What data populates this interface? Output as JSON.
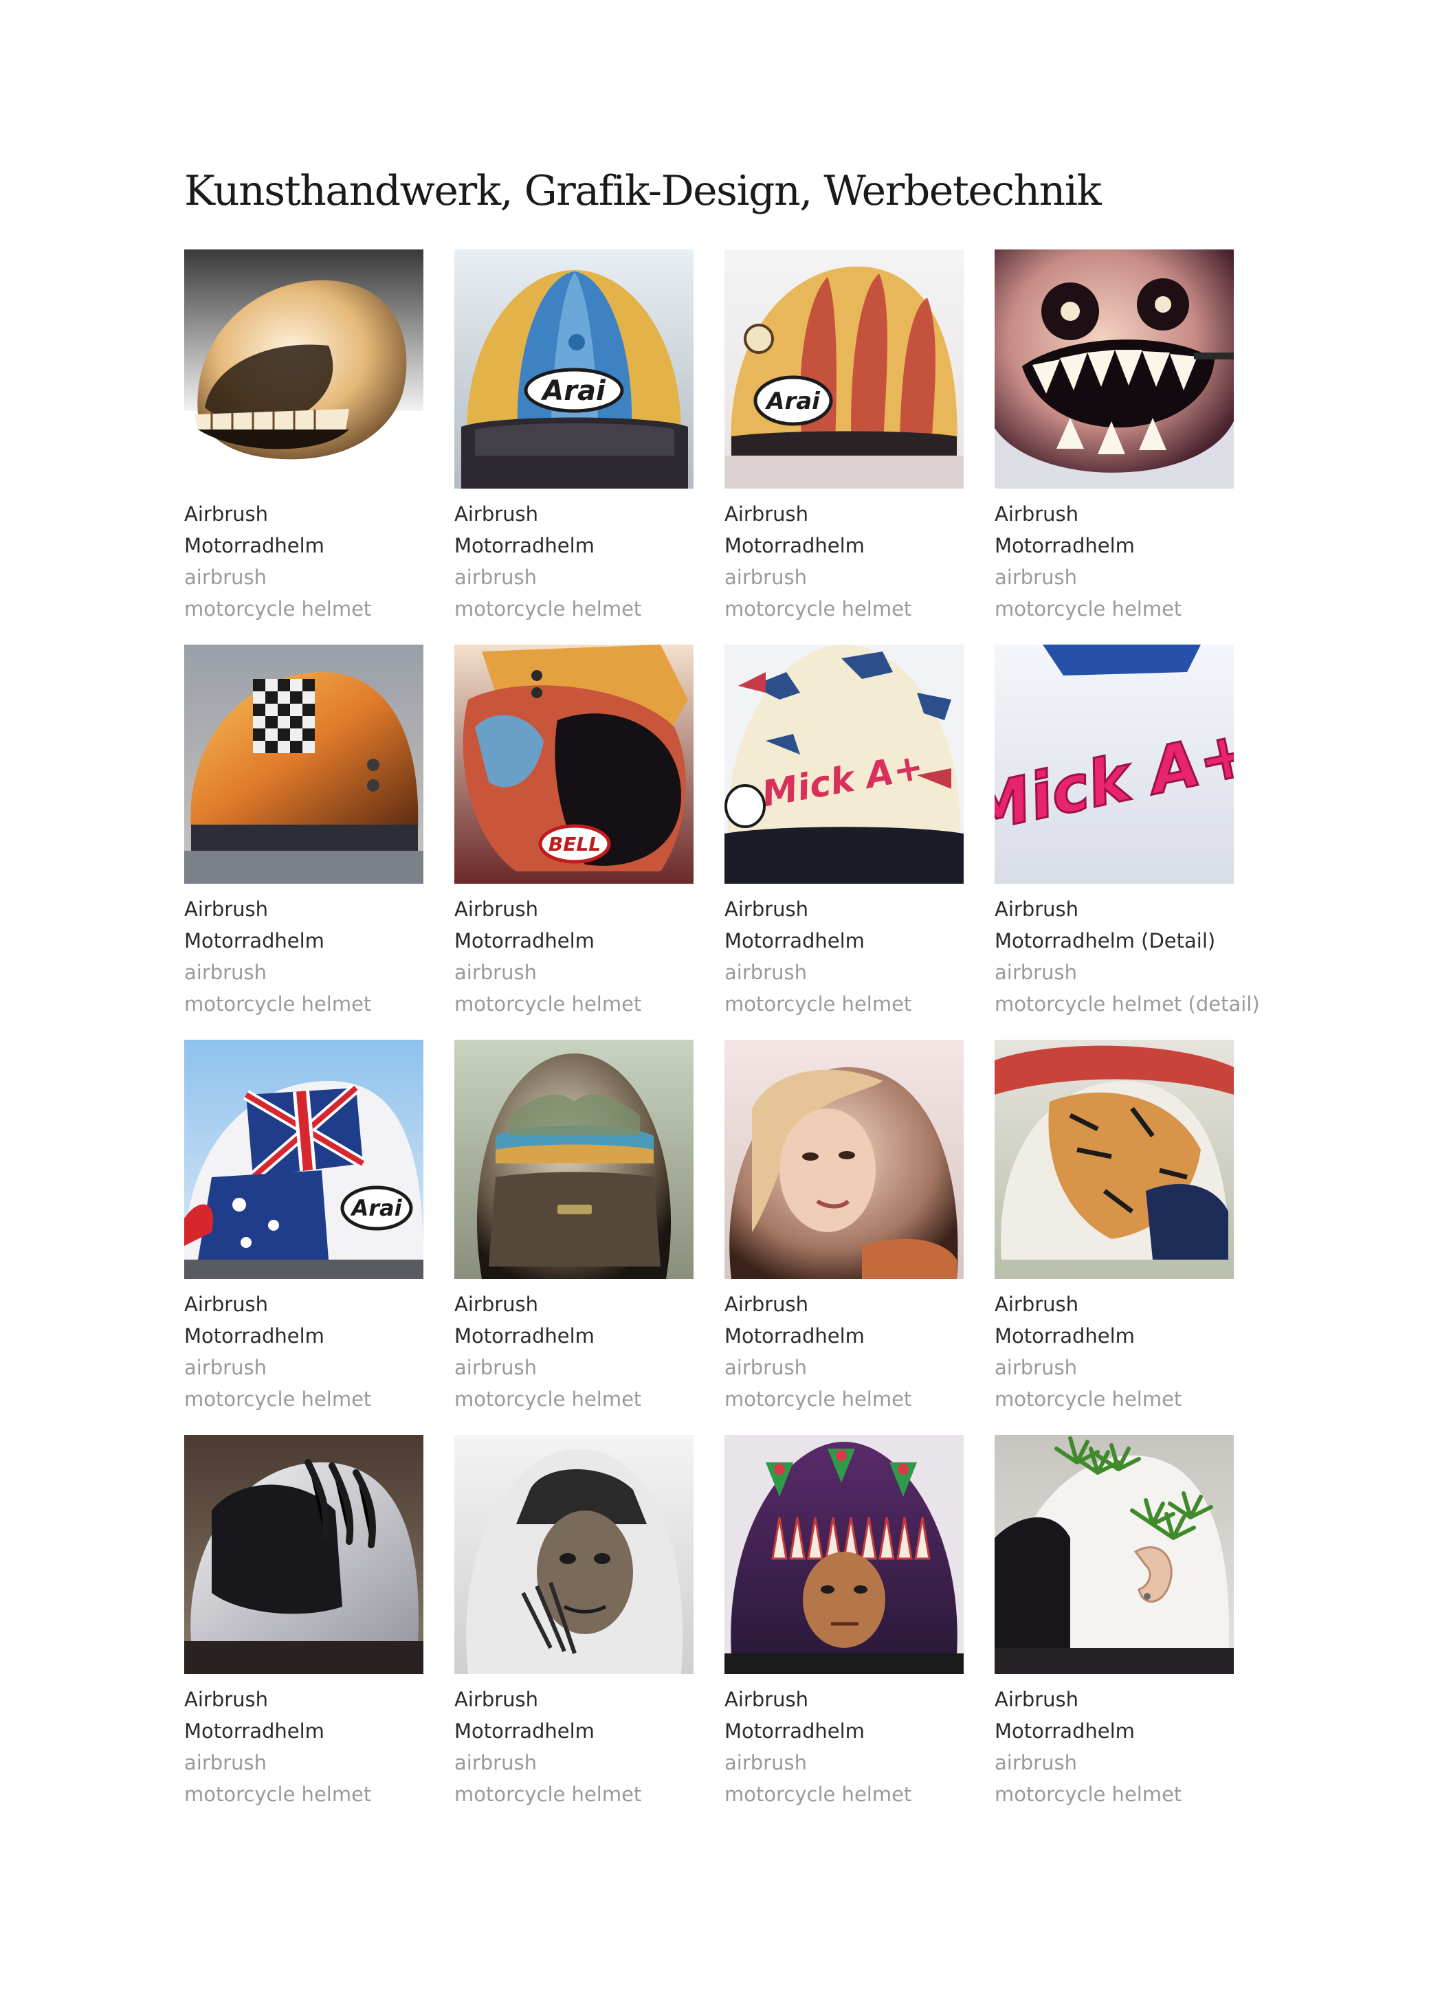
{
  "page": {
    "title": "Kunsthandwerk, Grafik-Design, Werbetechnik"
  },
  "colors": {
    "text_primary": "#2b2b2b",
    "text_secondary": "#9a9a9a",
    "background": "#ffffff"
  },
  "gallery": [
    {
      "line1": "Airbrush",
      "line2": "Motorradhelm",
      "line3": "airbrush",
      "line4": "motorcycle helmet",
      "image": "skull-face-helmet",
      "logo": ""
    },
    {
      "line1": "Airbrush",
      "line2": "Motorradhelm",
      "line3": "airbrush",
      "line4": "motorcycle helmet",
      "image": "blue-striped-arai-helmet",
      "logo": "Arai"
    },
    {
      "line1": "Airbrush",
      "line2": "Motorradhelm",
      "line3": "airbrush",
      "line4": "motorcycle helmet",
      "image": "red-yellow-striped-arai-helmet",
      "logo": "Arai"
    },
    {
      "line1": "Airbrush",
      "line2": "Motorradhelm",
      "line3": "airbrush",
      "line4": "motorcycle helmet",
      "image": "monster-teeth-helmet",
      "logo": ""
    },
    {
      "line1": "Airbrush",
      "line2": "Motorradhelm",
      "line3": "airbrush",
      "line4": "motorcycle helmet",
      "image": "checkered-flame-helmet",
      "logo": ""
    },
    {
      "line1": "Airbrush",
      "line2": "Motorradhelm",
      "line3": "airbrush",
      "line4": "motorcycle helmet",
      "image": "bell-motocross-helmet",
      "logo": "BELL"
    },
    {
      "line1": "Airbrush",
      "line2": "Motorradhelm",
      "line3": "airbrush",
      "line4": "motorcycle helmet",
      "image": "mick-a-plus-helmet",
      "logo": "Mick A+"
    },
    {
      "line1": "Airbrush",
      "line2": "Motorradhelm (Detail)",
      "line3": "airbrush",
      "line4": "motorcycle helmet (detail)",
      "image": "mick-a-plus-detail",
      "logo": "Mick A+"
    },
    {
      "line1": "Airbrush",
      "line2": "Motorradhelm",
      "line3": "airbrush",
      "line4": "motorcycle helmet",
      "image": "union-jack-arai-helmet",
      "logo": "Arai"
    },
    {
      "line1": "Airbrush",
      "line2": "Motorradhelm",
      "line3": "airbrush",
      "line4": "motorcycle helmet",
      "image": "landscape-dome-helmet",
      "logo": ""
    },
    {
      "line1": "Airbrush",
      "line2": "Motorradhelm",
      "line3": "airbrush",
      "line4": "motorcycle helmet",
      "image": "woman-portrait-helmet",
      "logo": ""
    },
    {
      "line1": "Airbrush",
      "line2": "Motorradhelm",
      "line3": "airbrush",
      "line4": "motorcycle helmet",
      "image": "tiger-helmet",
      "logo": ""
    },
    {
      "line1": "Airbrush",
      "line2": "Motorradhelm",
      "line3": "airbrush",
      "line4": "motorcycle helmet",
      "image": "claw-scratch-helmet",
      "logo": ""
    },
    {
      "line1": "Airbrush",
      "line2": "Motorradhelm",
      "line3": "airbrush",
      "line4": "motorcycle helmet",
      "image": "freddy-krueger-helmet",
      "logo": ""
    },
    {
      "line1": "Airbrush",
      "line2": "Motorradhelm",
      "line3": "airbrush",
      "line4": "motorcycle helmet",
      "image": "native-chief-helmet",
      "logo": ""
    },
    {
      "line1": "Airbrush",
      "line2": "Motorradhelm",
      "line3": "airbrush",
      "line4": "motorcycle helmet",
      "image": "ear-leaves-helmet",
      "logo": ""
    }
  ]
}
